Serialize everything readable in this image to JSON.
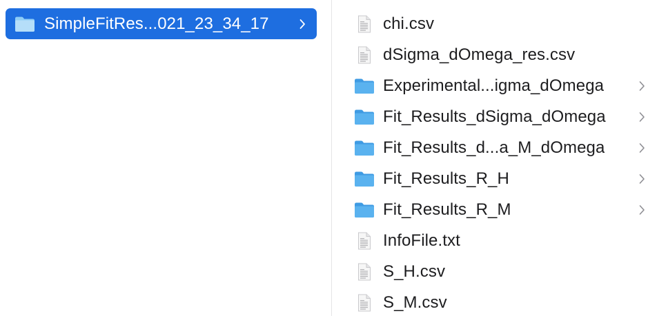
{
  "left_column": {
    "selected_folder": {
      "name": "SimpleFitRes...021_23_34_17",
      "icon": "folder-icon"
    }
  },
  "right_column": {
    "items": [
      {
        "name": "chi.csv",
        "type": "file",
        "icon": "document-icon"
      },
      {
        "name": "dSigma_dOmega_res.csv",
        "type": "file",
        "icon": "document-icon"
      },
      {
        "name": "Experimental...igma_dOmega",
        "type": "folder",
        "icon": "folder-icon"
      },
      {
        "name": "Fit_Results_dSigma_dOmega",
        "type": "folder",
        "icon": "folder-icon"
      },
      {
        "name": "Fit_Results_d...a_M_dOmega",
        "type": "folder",
        "icon": "folder-icon"
      },
      {
        "name": "Fit_Results_R_H",
        "type": "folder",
        "icon": "folder-icon"
      },
      {
        "name": "Fit_Results_R_M",
        "type": "folder",
        "icon": "folder-icon"
      },
      {
        "name": "InfoFile.txt",
        "type": "file",
        "icon": "document-icon"
      },
      {
        "name": "S_H.csv",
        "type": "file",
        "icon": "document-icon"
      },
      {
        "name": "S_M.csv",
        "type": "file",
        "icon": "document-icon"
      }
    ]
  },
  "colors": {
    "selection": "#1e6ee0",
    "folder_front": "#5ab2ef",
    "folder_back": "#3f9be3",
    "chevron": "#8e8e93"
  }
}
